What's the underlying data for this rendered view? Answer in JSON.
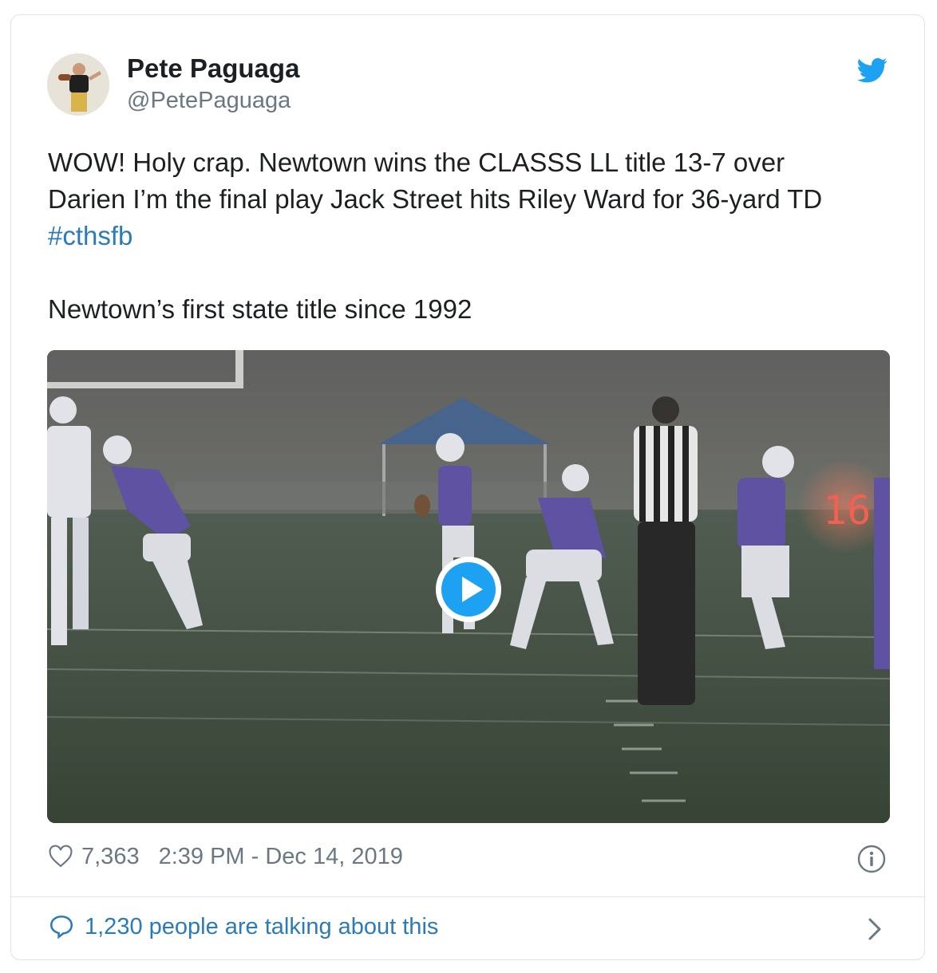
{
  "author": {
    "name": "Pete Paguaga",
    "handle": "@PetePaguaga"
  },
  "tweet": {
    "line1": "WOW! Holy crap. Newtown wins the CLASSS LL title 13-7 over",
    "line2": "Darien I’m the final play Jack Street hits Riley Ward for 36-yard TD",
    "hashtag": "#cthsfb",
    "line3": "Newtown’s first state title since 1992"
  },
  "media": {
    "scoreboard_digits": "16",
    "play_button_icon": "play-icon"
  },
  "meta": {
    "likes": "7,363",
    "timestamp": "2:39 PM - Dec 14, 2019"
  },
  "footer": {
    "conversation": "1,230 people are talking about this"
  },
  "colors": {
    "twitter_blue": "#1da1f2",
    "link_blue": "#2b7bb9",
    "muted": "#697882",
    "scoreboard_red": "#ff5a4a"
  }
}
